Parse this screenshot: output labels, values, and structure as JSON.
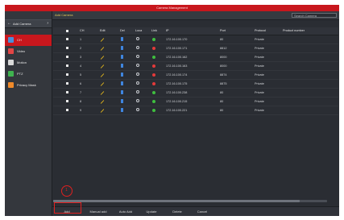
{
  "window": {
    "title": "Camera Management"
  },
  "sidebar": {
    "back_icon": "arrow-left",
    "header_label": "Add Camera",
    "items": [
      {
        "label": "CH",
        "icon": "camera-icon",
        "color": "#4a8fd8",
        "active": true
      },
      {
        "label": "Video",
        "icon": "video-icon",
        "color": "#e24545"
      },
      {
        "label": "Motion",
        "icon": "motion-icon",
        "color": "#d9d9d9"
      },
      {
        "label": "PTZ",
        "icon": "ptz-icon",
        "color": "#3fb34f"
      },
      {
        "label": "Privacy Mask",
        "icon": "privacy-mask-icon",
        "color": "#f08a2a"
      }
    ]
  },
  "topbar": {
    "breadcrumb": "Add Camera",
    "search_placeholder": "Search Camera"
  },
  "table": {
    "headers": {
      "ch": "CH",
      "edit": "Edit",
      "del": "Del",
      "loca": "Loca",
      "link": "Link",
      "ip": "IP",
      "port": "Port",
      "protocol": "Protocol",
      "product": "Product number"
    },
    "rows": [
      {
        "ch": "1",
        "ip": "172.16.100.170",
        "port": "80",
        "protocol": "Private",
        "status_color": "#3fbf3f"
      },
      {
        "ch": "2",
        "ip": "172.16.100.171",
        "port": "8812",
        "protocol": "Private",
        "status_color": "#e33a3a"
      },
      {
        "ch": "3",
        "ip": "172.16.100.162",
        "port": "8000",
        "protocol": "Private",
        "status_color": "#3fbf3f"
      },
      {
        "ch": "4",
        "ip": "172.16.100.163",
        "port": "8000",
        "protocol": "Private",
        "status_color": "#e33a3a"
      },
      {
        "ch": "5",
        "ip": "172.16.100.174",
        "port": "8874",
        "protocol": "Private",
        "status_color": "#e33a3a"
      },
      {
        "ch": "6",
        "ip": "172.16.100.175",
        "port": "8875",
        "protocol": "Private",
        "status_color": "#e33a3a"
      },
      {
        "ch": "7",
        "ip": "172.16.100.238",
        "port": "80",
        "protocol": "Private",
        "status_color": "#3fbf3f"
      },
      {
        "ch": "8",
        "ip": "172.16.100.215",
        "port": "80",
        "protocol": "Private",
        "status_color": "#3fbf3f"
      },
      {
        "ch": "9",
        "ip": "172.16.100.221",
        "port": "80",
        "protocol": "Private",
        "status_color": "#3fbf3f"
      }
    ]
  },
  "footer": {
    "buttons": [
      "Add",
      "Manual add",
      "Auto Add",
      "Update",
      "Delete",
      "Cancel"
    ]
  },
  "annotation": {
    "step": "1",
    "color": "#e02020"
  }
}
